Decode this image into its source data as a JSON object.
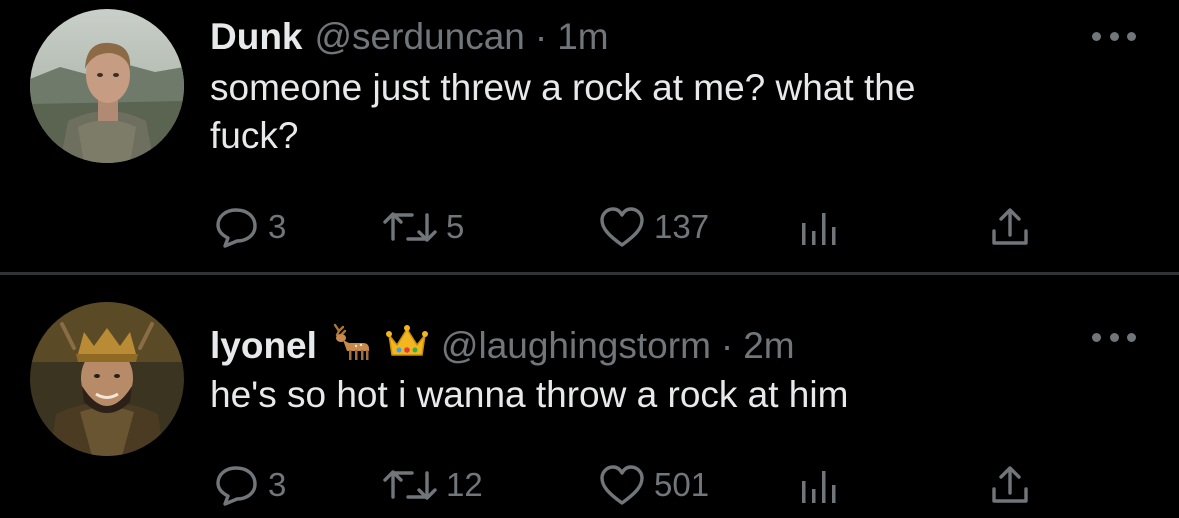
{
  "tweets": [
    {
      "display_name": "Dunk",
      "handle": "@serduncan",
      "separator": "·",
      "time": "1m",
      "text": "someone just threw a rock at me? what the\nfuck?",
      "badges": [],
      "avatar": "profile-photo-young-man",
      "stats": {
        "replies": "3",
        "retweets": "5",
        "likes": "137"
      }
    },
    {
      "display_name": "lyonel",
      "handle": "@laughingstorm",
      "separator": "·",
      "time": "2m",
      "text": "he's so hot i wanna throw a rock at him",
      "badges": [
        "deer-emoji",
        "crown-emoji"
      ],
      "avatar": "profile-photo-crowned-man",
      "stats": {
        "replies": "3",
        "retweets": "12",
        "likes": "501"
      }
    }
  ],
  "icons": {
    "reply": "reply-icon",
    "retweet": "retweet-icon",
    "like": "heart-icon",
    "views": "analytics-icon",
    "share": "share-icon",
    "more": "more-icon"
  },
  "colors": {
    "background": "#000000",
    "text": "#e7e9ea",
    "secondary": "#71767b",
    "divider": "#2f3336"
  }
}
